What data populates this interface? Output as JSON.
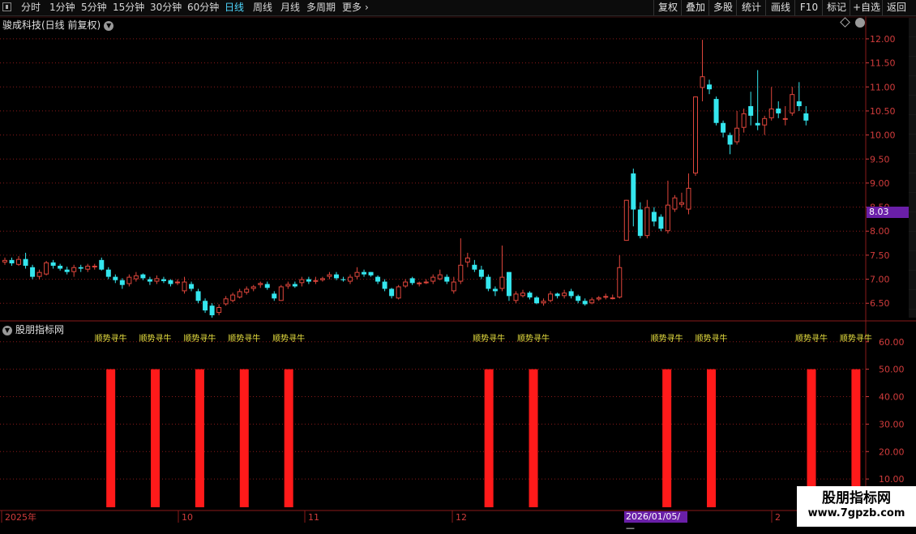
{
  "toolbar": {
    "periods": [
      "分时",
      "1分钟",
      "5分钟",
      "15分钟",
      "30分钟",
      "60分钟",
      "日线",
      "周线",
      "月线",
      "多周期",
      "更多"
    ],
    "active_period": "日线",
    "right_buttons": [
      "复权",
      "叠加",
      "多股",
      "统计",
      "画线",
      "F10",
      "标记",
      "+自选",
      "返回"
    ]
  },
  "main_panel": {
    "title": "骏成科技(日线 前复权)",
    "price_axis_labels": [
      "12.00",
      "11.50",
      "11.00",
      "10.50",
      "10.00",
      "9.50",
      "9.00",
      "8.50",
      "8.00",
      "7.50",
      "7.00",
      "6.50"
    ],
    "current_price_tag": "8.03"
  },
  "indicator_panel": {
    "title": "股朋指标网",
    "axis_labels": [
      "60.00",
      "50.00",
      "40.00",
      "30.00",
      "20.00",
      "10.00"
    ],
    "signal_label": "顺势寻牛",
    "signal_indices": [
      3,
      7,
      11,
      15,
      19,
      37,
      41,
      53,
      57,
      66,
      70
    ]
  },
  "date_axis": {
    "labels": [
      "2025年",
      "10",
      "11",
      "12",
      "2"
    ],
    "crosshair_date": "2026/01/05/—"
  },
  "watermark": {
    "title": "股朋指标网",
    "url": "www.7gpzb.com"
  },
  "colors": {
    "up": "#e0463c",
    "down": "#34e6ee",
    "grid": "#8a1a1a",
    "bar": "#ff1a1a",
    "signal_text": "#e8e040"
  },
  "chart_data": {
    "type": "candlestick",
    "price_range": [
      6.15,
      12.1
    ],
    "indicator_range": [
      0,
      62
    ],
    "indicator_bar_value": 50,
    "candles": [
      [
        7.35,
        7.4,
        7.3,
        7.45
      ],
      [
        7.4,
        7.33,
        7.28,
        7.45
      ],
      [
        7.3,
        7.42,
        7.28,
        7.48
      ],
      [
        7.42,
        7.28,
        7.22,
        7.55
      ],
      [
        7.25,
        7.05,
        7.0,
        7.3
      ],
      [
        7.05,
        7.15,
        7.0,
        7.2
      ],
      [
        7.1,
        7.35,
        7.08,
        7.38
      ],
      [
        7.35,
        7.28,
        7.22,
        7.4
      ],
      [
        7.28,
        7.22,
        7.18,
        7.32
      ],
      [
        7.2,
        7.15,
        7.1,
        7.26
      ],
      [
        7.15,
        7.25,
        7.05,
        7.3
      ],
      [
        7.25,
        7.22,
        7.15,
        7.3
      ],
      [
        7.2,
        7.28,
        7.15,
        7.32
      ],
      [
        7.25,
        7.28,
        7.2,
        7.32
      ],
      [
        7.4,
        7.2,
        7.18,
        7.45
      ],
      [
        7.2,
        7.05,
        7.0,
        7.25
      ],
      [
        7.05,
        6.98,
        6.92,
        7.1
      ],
      [
        6.98,
        6.88,
        6.8,
        7.02
      ],
      [
        6.9,
        7.05,
        6.85,
        7.1
      ],
      [
        7.0,
        7.08,
        6.95,
        7.15
      ],
      [
        7.1,
        7.02,
        6.98,
        7.12
      ],
      [
        7.0,
        6.95,
        6.88,
        7.05
      ],
      [
        6.95,
        7.02,
        6.9,
        7.08
      ],
      [
        7.0,
        6.96,
        6.92,
        7.05
      ],
      [
        6.98,
        6.9,
        6.85,
        7.0
      ],
      [
        6.92,
        6.95,
        6.88,
        7.0
      ],
      [
        6.75,
        6.95,
        6.7,
        7.05
      ],
      [
        6.9,
        6.8,
        6.75,
        6.95
      ],
      [
        6.75,
        6.55,
        6.5,
        6.8
      ],
      [
        6.55,
        6.35,
        6.3,
        6.6
      ],
      [
        6.45,
        6.25,
        6.2,
        6.5
      ],
      [
        6.3,
        6.42,
        6.25,
        6.48
      ],
      [
        6.48,
        6.6,
        6.45,
        6.65
      ],
      [
        6.55,
        6.68,
        6.52,
        6.72
      ],
      [
        6.62,
        6.75,
        6.6,
        6.8
      ],
      [
        6.72,
        6.8,
        6.68,
        6.85
      ],
      [
        6.8,
        6.85,
        6.75,
        6.88
      ],
      [
        6.88,
        6.92,
        6.82,
        6.95
      ],
      [
        6.9,
        6.82,
        6.78,
        6.95
      ],
      [
        6.7,
        6.6,
        6.55,
        6.75
      ],
      [
        6.55,
        6.85,
        6.55,
        6.88
      ],
      [
        6.85,
        6.9,
        6.8,
        6.95
      ],
      [
        6.9,
        6.85,
        6.82,
        6.95
      ],
      [
        6.92,
        7.0,
        6.85,
        7.05
      ],
      [
        7.0,
        6.95,
        6.9,
        7.05
      ],
      [
        6.95,
        6.98,
        6.9,
        7.05
      ],
      [
        6.98,
        7.02,
        6.95,
        7.05
      ],
      [
        7.05,
        7.1,
        7.0,
        7.15
      ],
      [
        7.1,
        7.02,
        6.98,
        7.15
      ],
      [
        7.0,
        6.98,
        6.95,
        7.05
      ],
      [
        6.95,
        7.05,
        6.9,
        7.1
      ],
      [
        7.05,
        7.15,
        7.0,
        7.25
      ],
      [
        7.15,
        7.1,
        7.05,
        7.2
      ],
      [
        7.15,
        7.08,
        7.05,
        7.15
      ],
      [
        7.05,
        6.95,
        6.9,
        7.08
      ],
      [
        6.95,
        6.8,
        6.75,
        7.0
      ],
      [
        6.8,
        6.65,
        6.6,
        6.82
      ],
      [
        6.6,
        6.85,
        6.58,
        6.88
      ],
      [
        6.85,
        6.95,
        6.82,
        7.0
      ],
      [
        7.02,
        6.92,
        6.88,
        7.05
      ],
      [
        6.9,
        6.93,
        6.85,
        6.95
      ],
      [
        6.92,
        6.95,
        6.9,
        7.0
      ],
      [
        6.95,
        7.05,
        6.9,
        7.1
      ],
      [
        7.0,
        7.1,
        6.98,
        7.2
      ],
      [
        7.05,
        6.95,
        6.9,
        7.1
      ],
      [
        6.75,
        6.95,
        6.7,
        7.05
      ],
      [
        6.95,
        7.3,
        6.9,
        7.85
      ],
      [
        7.35,
        7.45,
        7.25,
        7.55
      ],
      [
        7.3,
        7.2,
        7.15,
        7.4
      ],
      [
        7.2,
        7.05,
        7.0,
        7.28
      ],
      [
        7.05,
        6.8,
        6.75,
        7.1
      ],
      [
        6.8,
        6.75,
        6.65,
        6.85
      ],
      [
        6.8,
        7.05,
        6.75,
        7.7
      ],
      [
        7.15,
        6.65,
        6.55,
        7.15
      ],
      [
        6.55,
        6.7,
        6.5,
        6.75
      ],
      [
        6.65,
        6.72,
        6.62,
        6.78
      ],
      [
        6.72,
        6.62,
        6.58,
        6.75
      ],
      [
        6.62,
        6.5,
        6.48,
        6.65
      ],
      [
        6.5,
        6.55,
        6.45,
        6.6
      ],
      [
        6.55,
        6.7,
        6.52,
        6.75
      ],
      [
        6.7,
        6.65,
        6.6,
        6.72
      ],
      [
        6.65,
        6.72,
        6.6,
        6.78
      ],
      [
        6.75,
        6.65,
        6.6,
        6.8
      ],
      [
        6.65,
        6.55,
        6.5,
        6.68
      ],
      [
        6.55,
        6.48,
        6.45,
        6.6
      ],
      [
        6.5,
        6.58,
        6.48,
        6.62
      ],
      [
        6.58,
        6.62,
        6.55,
        6.65
      ],
      [
        6.62,
        6.65,
        6.58,
        6.7
      ],
      [
        6.6,
        6.62,
        6.58,
        6.68
      ],
      [
        6.62,
        7.25,
        6.6,
        7.5
      ],
      [
        7.8,
        8.65,
        7.8,
        8.65
      ],
      [
        9.2,
        8.45,
        8.1,
        9.3
      ],
      [
        8.45,
        7.9,
        7.85,
        8.6
      ],
      [
        7.9,
        8.5,
        7.85,
        8.65
      ],
      [
        8.4,
        8.2,
        8.1,
        8.5
      ],
      [
        8.3,
        8.05,
        8.0,
        8.35
      ],
      [
        8.0,
        8.55,
        7.95,
        9.05
      ],
      [
        8.45,
        8.7,
        8.4,
        8.75
      ],
      [
        8.55,
        8.6,
        8.5,
        8.8
      ],
      [
        8.45,
        8.9,
        8.35,
        9.2
      ],
      [
        9.2,
        10.8,
        9.15,
        10.8
      ],
      [
        10.98,
        11.22,
        10.7,
        11.98
      ],
      [
        11.05,
        10.95,
        10.85,
        11.15
      ],
      [
        10.75,
        10.25,
        10.2,
        10.8
      ],
      [
        10.25,
        10.05,
        9.95,
        10.3
      ],
      [
        10.0,
        9.8,
        9.6,
        10.05
      ],
      [
        9.85,
        10.15,
        9.8,
        10.5
      ],
      [
        10.15,
        10.45,
        10.05,
        10.55
      ],
      [
        10.6,
        10.4,
        10.2,
        10.9
      ],
      [
        10.25,
        10.2,
        10.1,
        11.35
      ],
      [
        10.2,
        10.35,
        10.0,
        10.4
      ],
      [
        10.35,
        10.55,
        10.3,
        11.0
      ],
      [
        10.55,
        10.45,
        10.35,
        10.7
      ],
      [
        10.35,
        10.35,
        10.2,
        10.6
      ],
      [
        10.45,
        10.85,
        10.4,
        11.0
      ],
      [
        10.7,
        10.6,
        10.5,
        11.1
      ],
      [
        10.45,
        10.3,
        10.2,
        10.6
      ]
    ]
  }
}
